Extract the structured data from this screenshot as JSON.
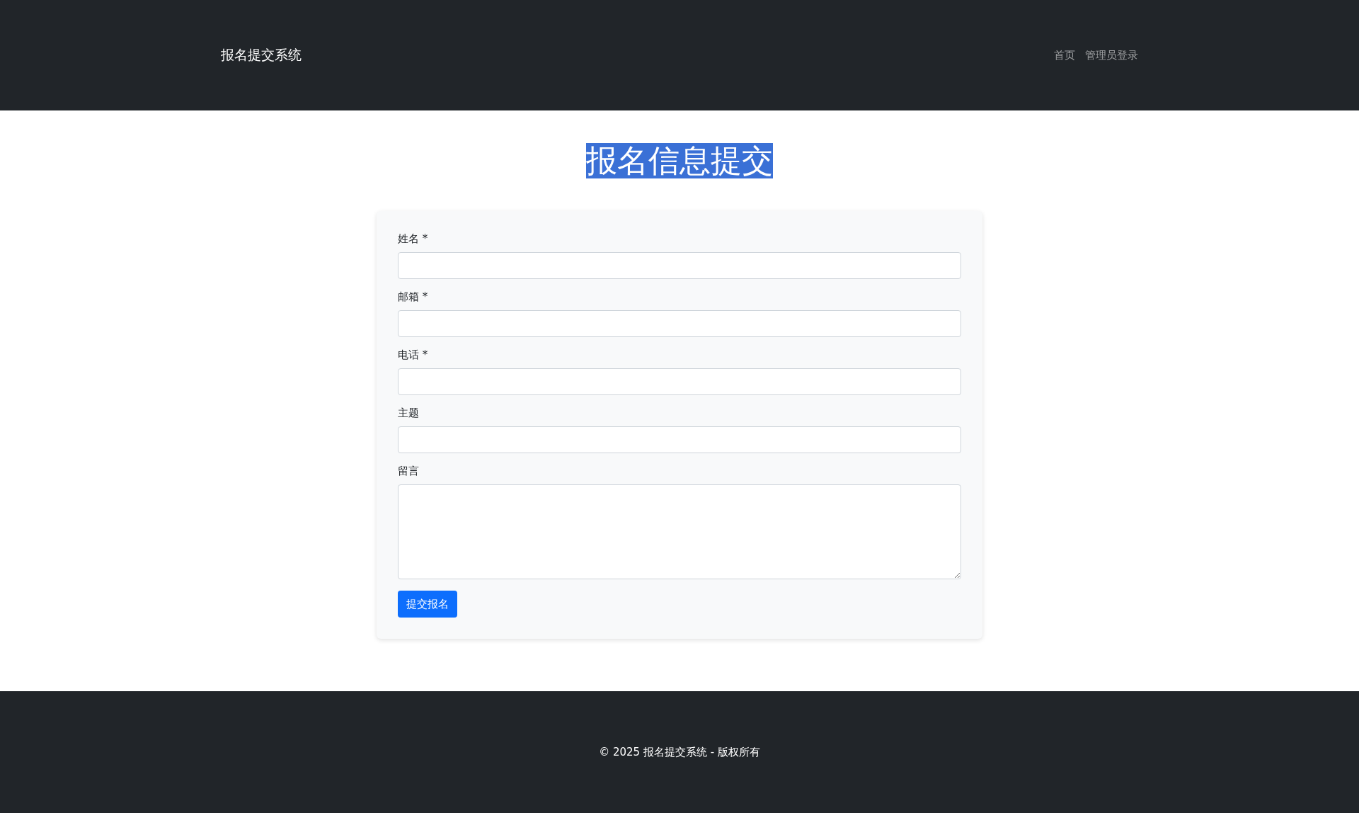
{
  "header": {
    "brand": "报名提交系统",
    "nav": [
      {
        "label": "首页"
      },
      {
        "label": "管理员登录"
      }
    ]
  },
  "page_title": {
    "text": "报名信息提交",
    "highlighted": true
  },
  "form": {
    "fields": [
      {
        "label": "姓名 *",
        "kind": "input"
      },
      {
        "label": "邮箱 *",
        "kind": "input"
      },
      {
        "label": "电话 *",
        "kind": "input"
      },
      {
        "label": "主题",
        "kind": "input"
      },
      {
        "label": "留言",
        "kind": "textarea"
      }
    ],
    "submit": "提交报名"
  },
  "footer": {
    "text": "© 2025 报名提交系统 - 版权所有"
  }
}
